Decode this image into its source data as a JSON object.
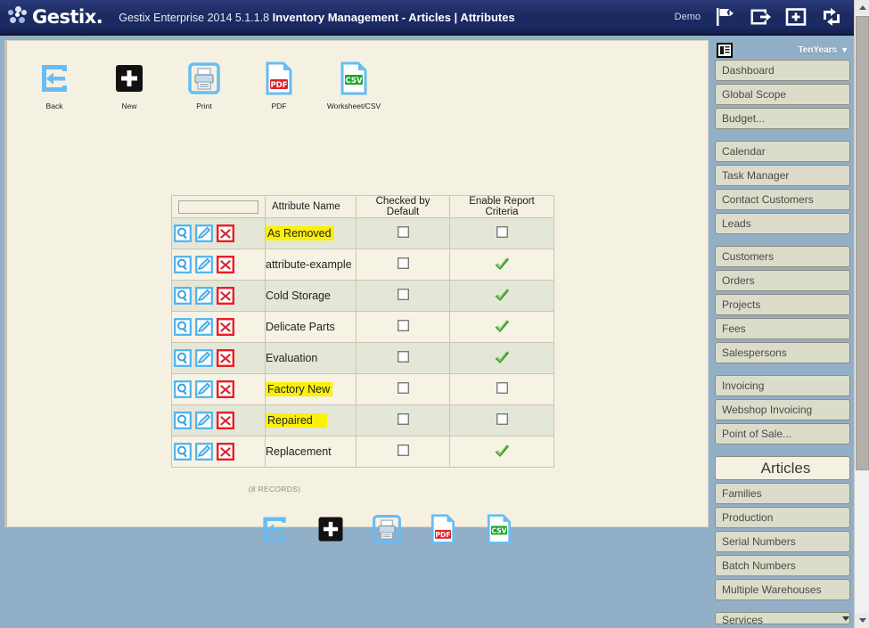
{
  "header": {
    "logo_text": "Gestix.",
    "title_prefix": "Gestix Enterprise 2014 5.1.1.8",
    "title_main": "Inventory Management - Articles | Attributes",
    "user_label": "Demo",
    "icons": [
      "flag-icon",
      "logout-icon",
      "add-icon",
      "sync-icon"
    ]
  },
  "toolbar": {
    "items": [
      {
        "label": "Back",
        "icon": "back-arrow-icon"
      },
      {
        "label": "New",
        "icon": "plus-square-icon"
      },
      {
        "label": "Print",
        "icon": "printer-icon"
      },
      {
        "label": "PDF",
        "icon": "pdf-file-icon"
      },
      {
        "label": "Worksheet/CSV",
        "icon": "csv-file-icon"
      }
    ]
  },
  "grid": {
    "columns": [
      "",
      "Attribute Name",
      "Checked by Default",
      "Enable Report Criteria"
    ],
    "filter_value": "",
    "filter_placeholder": "",
    "rows": [
      {
        "name": "As Removed",
        "highlight": true,
        "checked_by_default": false,
        "enable_report_criteria": false
      },
      {
        "name": "attribute-example",
        "highlight": false,
        "checked_by_default": false,
        "enable_report_criteria": true
      },
      {
        "name": "Cold Storage",
        "highlight": false,
        "checked_by_default": false,
        "enable_report_criteria": true
      },
      {
        "name": "Delicate Parts",
        "highlight": false,
        "checked_by_default": false,
        "enable_report_criteria": true
      },
      {
        "name": "Evaluation",
        "highlight": false,
        "checked_by_default": false,
        "enable_report_criteria": true
      },
      {
        "name": "Factory New",
        "highlight": true,
        "checked_by_default": false,
        "enable_report_criteria": false
      },
      {
        "name": "Repaired",
        "highlight": true,
        "checked_by_default": false,
        "enable_report_criteria": false
      },
      {
        "name": "Replacement",
        "highlight": false,
        "checked_by_default": false,
        "enable_report_criteria": true
      }
    ],
    "row_actions": [
      "view-icon",
      "edit-icon",
      "delete-icon"
    ],
    "records_label": "(8 RECORDS)"
  },
  "sidebar": {
    "company": "TenYears",
    "caret": "▼",
    "groups": [
      {
        "items": [
          {
            "label": "Dashboard",
            "type": "item"
          },
          {
            "label": "Global Scope",
            "type": "item"
          },
          {
            "label": "Budget...",
            "type": "item"
          }
        ]
      },
      {
        "items": [
          {
            "label": "Calendar",
            "type": "item"
          },
          {
            "label": "Task Manager",
            "type": "item"
          },
          {
            "label": "Contact Customers",
            "type": "item"
          },
          {
            "label": "Leads",
            "type": "item"
          }
        ]
      },
      {
        "items": [
          {
            "label": "Customers",
            "type": "item"
          },
          {
            "label": "Orders",
            "type": "item"
          },
          {
            "label": "Projects",
            "type": "item"
          },
          {
            "label": "Fees",
            "type": "item"
          },
          {
            "label": "Salespersons",
            "type": "item"
          }
        ]
      },
      {
        "items": [
          {
            "label": "Invoicing",
            "type": "item"
          },
          {
            "label": "Webshop Invoicing",
            "type": "item"
          },
          {
            "label": "Point of Sale...",
            "type": "item"
          }
        ]
      },
      {
        "items": [
          {
            "label": "Articles",
            "type": "section"
          },
          {
            "label": "Families",
            "type": "item"
          },
          {
            "label": "Production",
            "type": "item"
          },
          {
            "label": "Serial Numbers",
            "type": "item"
          },
          {
            "label": "Batch Numbers",
            "type": "item"
          },
          {
            "label": "Multiple Warehouses",
            "type": "item"
          }
        ]
      },
      {
        "items": [
          {
            "label": "Services",
            "type": "clipped"
          }
        ]
      }
    ]
  },
  "colors": {
    "header_blue": "#1c2a61",
    "body_blue": "#92afc8",
    "panel_cream": "#f5f1e2",
    "row_alt": "#e4e7d8",
    "highlight_yellow": "#fbf00a",
    "check_green": "#3a9b2e",
    "delete_red": "#e8262a",
    "icon_blue": "#67bdf2"
  }
}
